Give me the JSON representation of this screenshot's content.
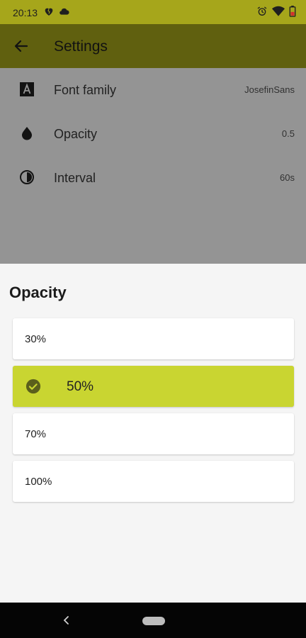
{
  "status_bar": {
    "time": "20:13",
    "left_icons": [
      "broken-heart-icon",
      "cloud-icon"
    ],
    "right_icons": [
      "alarm-icon",
      "wifi-icon",
      "battery-icon"
    ]
  },
  "app_bar": {
    "title": "Settings",
    "back_icon": "arrow-back-icon",
    "color": "#a6a61b"
  },
  "settings": [
    {
      "icon": "font-icon",
      "label": "Font family",
      "value": "JosefinSans"
    },
    {
      "icon": "drop-icon",
      "label": "Opacity",
      "value": "0.5"
    },
    {
      "icon": "timer-icon",
      "label": "Interval",
      "value": "60s"
    }
  ],
  "sheet": {
    "title": "Opacity",
    "options": [
      {
        "label": "30%",
        "selected": false
      },
      {
        "label": "50%",
        "selected": true
      },
      {
        "label": "70%",
        "selected": false
      },
      {
        "label": "100%",
        "selected": false
      }
    ],
    "selected_color": "#c9d531"
  }
}
